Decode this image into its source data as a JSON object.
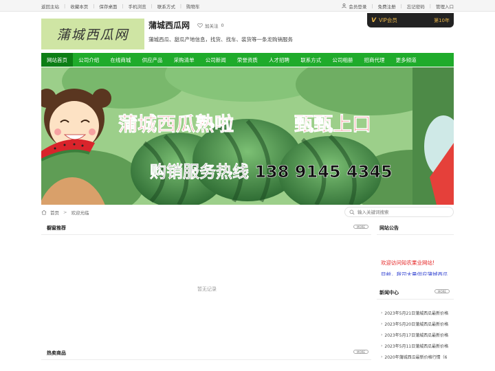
{
  "topbar": {
    "left_links": [
      "返回主站",
      "收藏本页",
      "保存桌面",
      "手机浏览",
      "联系方式",
      "购物车"
    ],
    "right_links": [
      "会员登录",
      "免费注册",
      "忘记密码",
      "管理入口"
    ]
  },
  "header": {
    "logo_text": "蒲城西瓜网",
    "site_name": "蒲城西瓜网",
    "follow_label": "加关注",
    "follow_count": "0",
    "description": "蒲城西瓜、甜瓜产地信息，找货、找车、装货等一条龙购销服务",
    "vip_label": "VIP会员",
    "vip_years": "第10年"
  },
  "nav": {
    "items": [
      "网站首页",
      "公司介绍",
      "在线商城",
      "供应产品",
      "采购清单",
      "公司新闻",
      "荣誉资质",
      "人才招聘",
      "联系方式",
      "公司相册",
      "招商代理",
      "更多频道"
    ]
  },
  "banner": {
    "headline_part1": "蒲城西瓜熟啦",
    "headline_part2": "甄甄上口",
    "hotline": "购销服务热线 138 9145 4345"
  },
  "breadcrumb": {
    "home": "首页",
    "sep": ">",
    "current": "欢迎光临"
  },
  "search": {
    "placeholder": "输入关键词搜索"
  },
  "sections": {
    "showcase_title": "橱窗推荐",
    "showcase_empty": "暂无记录",
    "hot_title": "热卖商品",
    "more_label": "MORE",
    "notice_title": "网站公告",
    "notice_line1": "欢迎访问知农果业网站!",
    "notice_line2": "目前，我司大量供应蒲城西瓜",
    "news_title": "新闻中心",
    "news_items": [
      "2023年5月21日蒲城西瓜最新价格",
      "2023年5月20日蒲城西瓜最新价格",
      "2023年5月17日蒲城西瓜最新价格",
      "2023年5月11日蒲城西瓜最新价格",
      "2020年蒲城西瓜最新价格行情（6"
    ]
  },
  "colors": {
    "nav_green": "#1fab2b",
    "nav_active": "#0d7e15",
    "vip_gold": "#e9b54a",
    "notice_red": "#e41f1f",
    "notice_blue": "#2b3ccf"
  }
}
